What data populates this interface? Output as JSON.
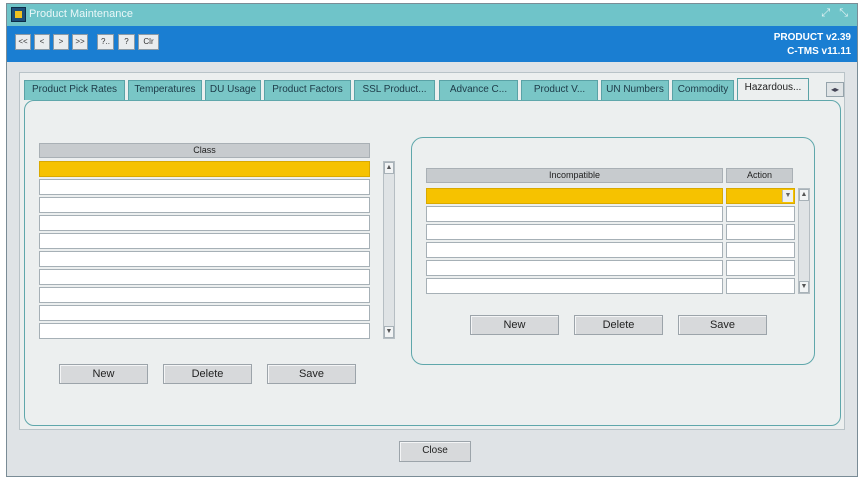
{
  "window": {
    "title": "Product Maintenance",
    "controls": "⤢ ⤡"
  },
  "toolbar": {
    "buttons": [
      "<<",
      "<",
      ">",
      ">>",
      "?..",
      "?",
      "Clr"
    ],
    "version_line1": "PRODUCT v2.39",
    "version_line2": "C-TMS v11.11"
  },
  "tabs": [
    "Product Pick Rates",
    "Temperatures",
    "DU Usage",
    "Product Factors",
    "SSL Product...",
    "Advance C...",
    "Product V...",
    "UN Numbers",
    "Commodity",
    "Hazardous..."
  ],
  "active_tab": "Hazardous...",
  "tab_scroll": "◂▸",
  "class_table": {
    "header": "Class",
    "rows": [
      "",
      "",
      "",
      "",
      "",
      "",
      "",
      "",
      "",
      ""
    ],
    "selected_row": 0
  },
  "class_buttons": {
    "new": "New",
    "delete": "Delete",
    "save": "Save"
  },
  "incompatible_table": {
    "header_incompatible": "Incompatible",
    "header_action": "Action",
    "rows": [
      "",
      "",
      "",
      "",
      "",
      ""
    ],
    "selected_row": 0
  },
  "incompatible_buttons": {
    "new": "New",
    "delete": "Delete",
    "save": "Save"
  },
  "footer": {
    "close": "Close"
  },
  "colors": {
    "selection": "#f6c200",
    "toolbar": "#1a7ed2",
    "titlebar": "#6fc4c9",
    "tab": "#79c6c6"
  }
}
